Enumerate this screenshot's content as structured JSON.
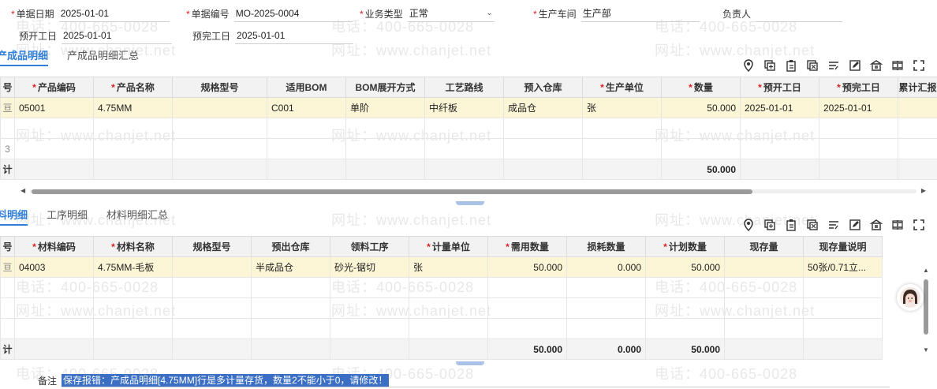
{
  "header": {
    "doc_date_label": "单据日期",
    "doc_date": "2025-01-01",
    "doc_no_label": "单据编号",
    "doc_no": "MO-2025-0004",
    "biz_type_label": "业务类型",
    "biz_type": "正常",
    "workshop_label": "生产车间",
    "workshop": "生产部",
    "owner_label": "负责人",
    "owner": "",
    "plan_start_label": "预开工日",
    "plan_start": "2025-01-01",
    "plan_end_label": "预完工日",
    "plan_end": "2025-01-01"
  },
  "product_tabs": [
    "产成品明细",
    "产成品明细汇总"
  ],
  "product_grid": {
    "columns": [
      "号",
      "产品编码",
      "产品名称",
      "规格型号",
      "适用BOM",
      "BOM展开方式",
      "工艺路线",
      "预入仓库",
      "生产单位",
      "数量",
      "预开工日",
      "预完工日",
      "累计汇报"
    ],
    "required": [
      false,
      true,
      true,
      false,
      false,
      false,
      false,
      false,
      true,
      true,
      true,
      true,
      false
    ],
    "rows": [
      [
        "亘",
        "05001",
        "4.75MM",
        "",
        "C001",
        "单阶",
        "中纤板",
        "成品仓",
        "张",
        "50.000",
        "2025-01-01",
        "2025-01-01",
        ""
      ],
      [
        "",
        "",
        "",
        "",
        "",
        "",
        "",
        "",
        "",
        "",
        "",
        "",
        ""
      ],
      [
        "3",
        "",
        "",
        "",
        "",
        "",
        "",
        "",
        "",
        "",
        "",
        "",
        ""
      ]
    ],
    "total_label": "计",
    "total_qty": "50.000"
  },
  "material_tabs": [
    "料明细",
    "工序明细",
    "材料明细汇总"
  ],
  "material_grid": {
    "columns": [
      "号",
      "材料编码",
      "材料名称",
      "规格型号",
      "预出仓库",
      "领料工序",
      "计量单位",
      "需用数量",
      "损耗数量",
      "计划数量",
      "现存量",
      "现存量说明"
    ],
    "required": [
      false,
      true,
      true,
      false,
      false,
      false,
      true,
      true,
      false,
      true,
      false,
      false
    ],
    "rows": [
      [
        "亘",
        "04003",
        "4.75MM-毛板",
        "",
        "半成品仓",
        "砂光-锯切",
        "张",
        "50.000",
        "0.000",
        "50.000",
        "",
        "50张/0.71立..."
      ],
      [
        "",
        "",
        "",
        "",
        "",
        "",
        "",
        "",
        "",
        "",
        "",
        ""
      ],
      [
        "",
        "",
        "",
        "",
        "",
        "",
        "",
        "",
        "",
        "",
        "",
        ""
      ],
      [
        "",
        "",
        "",
        "",
        "",
        "",
        "",
        "",
        "",
        "",
        "",
        ""
      ]
    ],
    "total_label": "计",
    "total_need": "50.000",
    "total_loss": "0.000",
    "total_plan": "50.000"
  },
  "remark": {
    "label": "备注",
    "selected_text": "保存报错：产成品明细[4.75MM]行是多计量存货，数量2不能小于0，请修改！"
  },
  "watermark": {
    "phone": "电话：400-665-0028",
    "site": "网址：www.chanjet.net"
  },
  "toolbar_icons": [
    "location-icon",
    "copy-row-icon",
    "paste-icon",
    "delete-row-icon",
    "sort-icon",
    "edit-icon",
    "bank-icon",
    "split-icon",
    "fullscreen-icon"
  ],
  "colors": {
    "accent": "#2f7ed8",
    "selected_row": "#fdf6d6",
    "required": "#e02020",
    "selection": "#3a6fc4"
  }
}
